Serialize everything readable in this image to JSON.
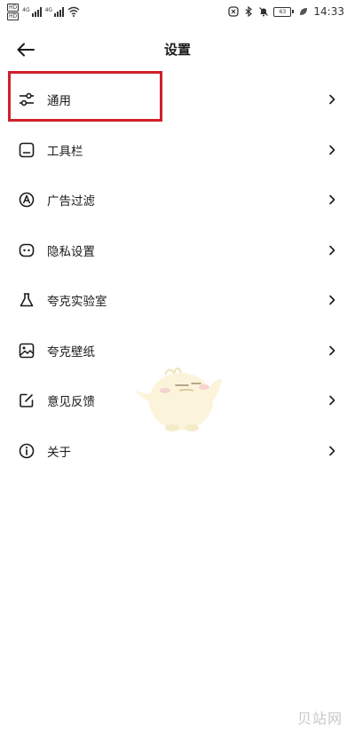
{
  "status_bar": {
    "hd_badges": [
      "HD",
      "HD"
    ],
    "network_tags": [
      "4G",
      "4G"
    ],
    "battery_level": "63",
    "time": "14:33",
    "icons": [
      "nfc-icon",
      "bluetooth-icon",
      "bell-off-icon",
      "battery-icon",
      "leaf-icon"
    ]
  },
  "header": {
    "title": "设置"
  },
  "settings": {
    "items": [
      {
        "label": "通用",
        "icon": "sliders-icon"
      },
      {
        "label": "工具栏",
        "icon": "toolbar-icon"
      },
      {
        "label": "广告过滤",
        "icon": "ad-filter-icon"
      },
      {
        "label": "隐私设置",
        "icon": "privacy-mask-icon"
      },
      {
        "label": "夸克实验室",
        "icon": "flask-icon"
      },
      {
        "label": "夸克壁纸",
        "icon": "wallpaper-image-icon"
      },
      {
        "label": "意见反馈",
        "icon": "edit-feedback-icon"
      },
      {
        "label": "关于",
        "icon": "info-icon"
      }
    ]
  },
  "highlight": {
    "color": "#d0202a",
    "target": "通用"
  },
  "watermark": "贝站网"
}
